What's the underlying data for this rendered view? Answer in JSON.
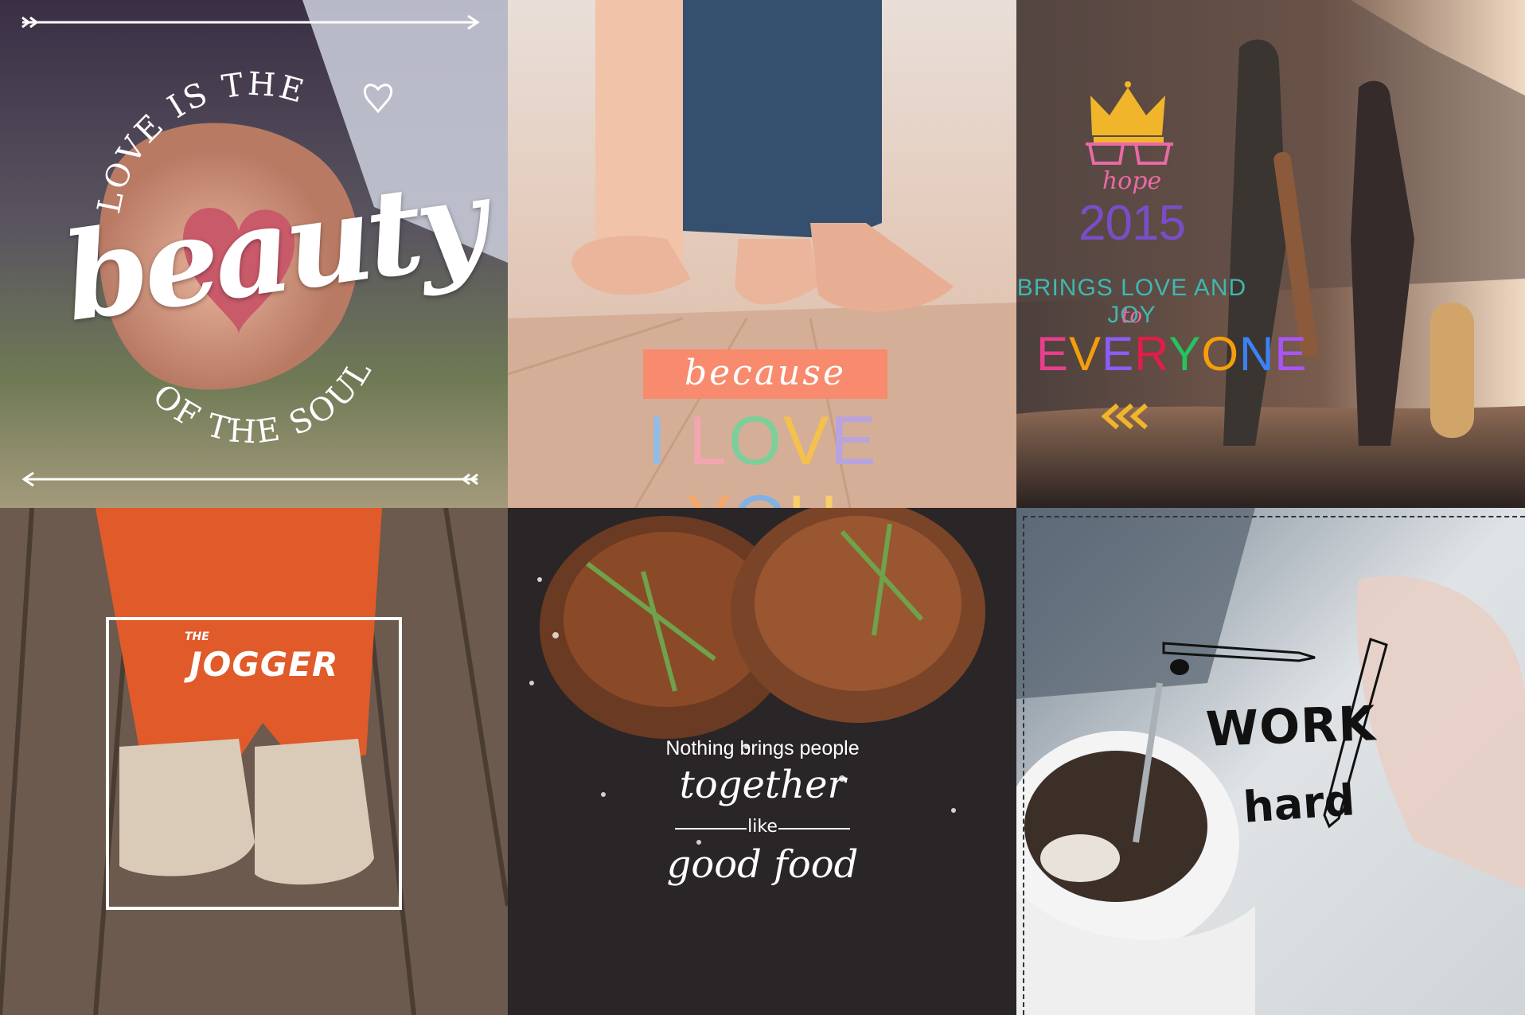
{
  "tiles": {
    "t1": {
      "top_arc": "LOVE IS THE",
      "main": "beauty",
      "bottom_arc": "OF THE SOUL"
    },
    "t2": {
      "script": "because",
      "main": [
        "I ",
        "L",
        "O",
        "V",
        "E",
        " ",
        "Y",
        "O",
        "U"
      ]
    },
    "t3": {
      "hope": "hope",
      "year": "2015",
      "line1": "BRINGS LOVE AND JOY",
      "to": "to",
      "everyone": [
        "E",
        "V",
        "E",
        "R",
        "Y",
        "O",
        "N",
        "E"
      ]
    },
    "t4": {
      "small": "THE",
      "main": "JOGGER"
    },
    "t5": {
      "line1": "Nothing brings people",
      "line2": "together",
      "line3": "like",
      "line4": "good food"
    },
    "t6": {
      "line1": "WORK",
      "line2": "hard"
    }
  },
  "colors": {
    "coral": "#f88a6d",
    "iloveyou": [
      "#8fbde8",
      "#f2a7b0",
      "#7ccf9a",
      "#f4c04e",
      "#b7a3e0",
      "#ffffff",
      "#f6a86a",
      "#7fb2e6",
      "#f7d06a"
    ],
    "everyone": [
      "#e83e8c",
      "#f59e0b",
      "#8b5cf6",
      "#e11d48",
      "#22c55e",
      "#f59e0b",
      "#3b82f6",
      "#a855f7"
    ],
    "t3_teal": "#3fb8b0",
    "t3_gold": "#f0b52a",
    "t3_purple": "#7a4dc8",
    "t3_pink": "#e86aa6"
  }
}
